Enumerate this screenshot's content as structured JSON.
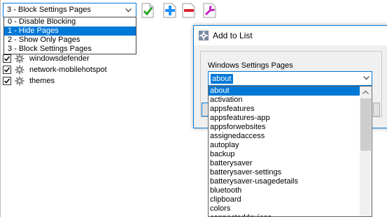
{
  "mode_combo": {
    "value": "3 - Block Settings Pages",
    "options": [
      "0 - Disable Blocking",
      "1 - Hide Pages",
      "2 - Show Only Pages",
      "3 - Block Settings Pages"
    ],
    "highlighted_index": 1
  },
  "toolbar": {
    "icons": [
      "check-icon",
      "add-icon",
      "remove-icon",
      "edit-settings-icon"
    ]
  },
  "items": [
    {
      "label": "windowsdefender",
      "checked": true
    },
    {
      "label": "network-mobilehotspot",
      "checked": true
    },
    {
      "label": "themes",
      "checked": true
    }
  ],
  "dialog": {
    "title": "Add to List",
    "group_label": "Windows Settings Pages",
    "page_combo_value": "about",
    "page_options": [
      "about",
      "activation",
      "appsfeatures",
      "appsfeatures-app",
      "appsforwebsites",
      "assignedaccess",
      "autoplay",
      "backup",
      "batterysaver",
      "batterysaver-settings",
      "batterysaver-usagedetails",
      "bluetooth",
      "clipboard",
      "colors",
      "connecteddevices"
    ],
    "selected_index": 0
  },
  "colors": {
    "accent": "#0078d7",
    "check_green": "#2aa52a",
    "add_blue": "#1e90ff",
    "remove_red": "#d9232d",
    "edit_purple": "#c21fc2"
  }
}
